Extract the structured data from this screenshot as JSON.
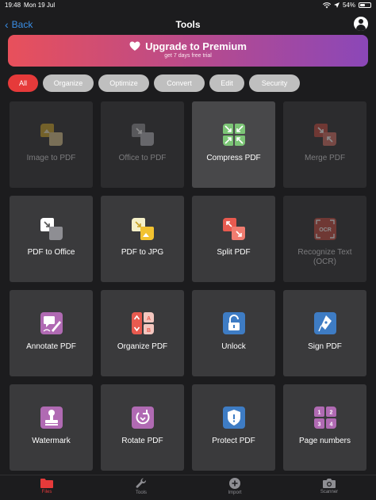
{
  "status": {
    "time": "19:48",
    "date": "Mon 19 Jul",
    "battery": "54%",
    "battery_level": 0.54
  },
  "nav": {
    "back_label": "Back",
    "title": "Tools"
  },
  "banner": {
    "title": "Upgrade to Premium",
    "subtitle": "get 7 days free trial"
  },
  "filters": [
    "All",
    "Organize",
    "Optimize",
    "Convert",
    "Edit",
    "Security"
  ],
  "tiles": [
    {
      "label": "Image to PDF",
      "icon": "image-to-pdf-icon",
      "state": "disabled"
    },
    {
      "label": "Office to PDF",
      "icon": "office-to-pdf-icon",
      "state": "disabled"
    },
    {
      "label": "Compress PDF",
      "icon": "compress-icon",
      "state": "highlighted"
    },
    {
      "label": "Merge PDF",
      "icon": "merge-icon",
      "state": "disabled"
    },
    {
      "label": "PDF to Office",
      "icon": "pdf-to-office-icon",
      "state": "normal"
    },
    {
      "label": "PDF to JPG",
      "icon": "pdf-to-jpg-icon",
      "state": "normal"
    },
    {
      "label": "Split PDF",
      "icon": "split-icon",
      "state": "normal"
    },
    {
      "label": "Recognize Text (OCR)",
      "icon": "ocr-icon",
      "state": "disabled"
    },
    {
      "label": "Annotate PDF",
      "icon": "annotate-icon",
      "state": "normal"
    },
    {
      "label": "Organize PDF",
      "icon": "organize-icon",
      "state": "normal"
    },
    {
      "label": "Unlock",
      "icon": "unlock-icon",
      "state": "normal"
    },
    {
      "label": "Sign PDF",
      "icon": "sign-icon",
      "state": "normal"
    },
    {
      "label": "Watermark",
      "icon": "watermark-icon",
      "state": "normal"
    },
    {
      "label": "Rotate PDF",
      "icon": "rotate-icon",
      "state": "normal"
    },
    {
      "label": "Protect PDF",
      "icon": "protect-icon",
      "state": "normal"
    },
    {
      "label": "Page numbers",
      "icon": "page-numbers-icon",
      "state": "normal"
    }
  ],
  "tabs": [
    {
      "label": "Files",
      "icon": "folder-icon",
      "active": true
    },
    {
      "label": "Tools",
      "icon": "wrench-icon",
      "active": false
    },
    {
      "label": "Import",
      "icon": "plus-circle-icon",
      "active": false
    },
    {
      "label": "Scanner",
      "icon": "camera-icon",
      "active": false
    }
  ],
  "colors": {
    "accent": "#e63a3a",
    "link": "#3a8ee6",
    "background": "#1c1c1e",
    "tile": "#3a3a3c"
  }
}
